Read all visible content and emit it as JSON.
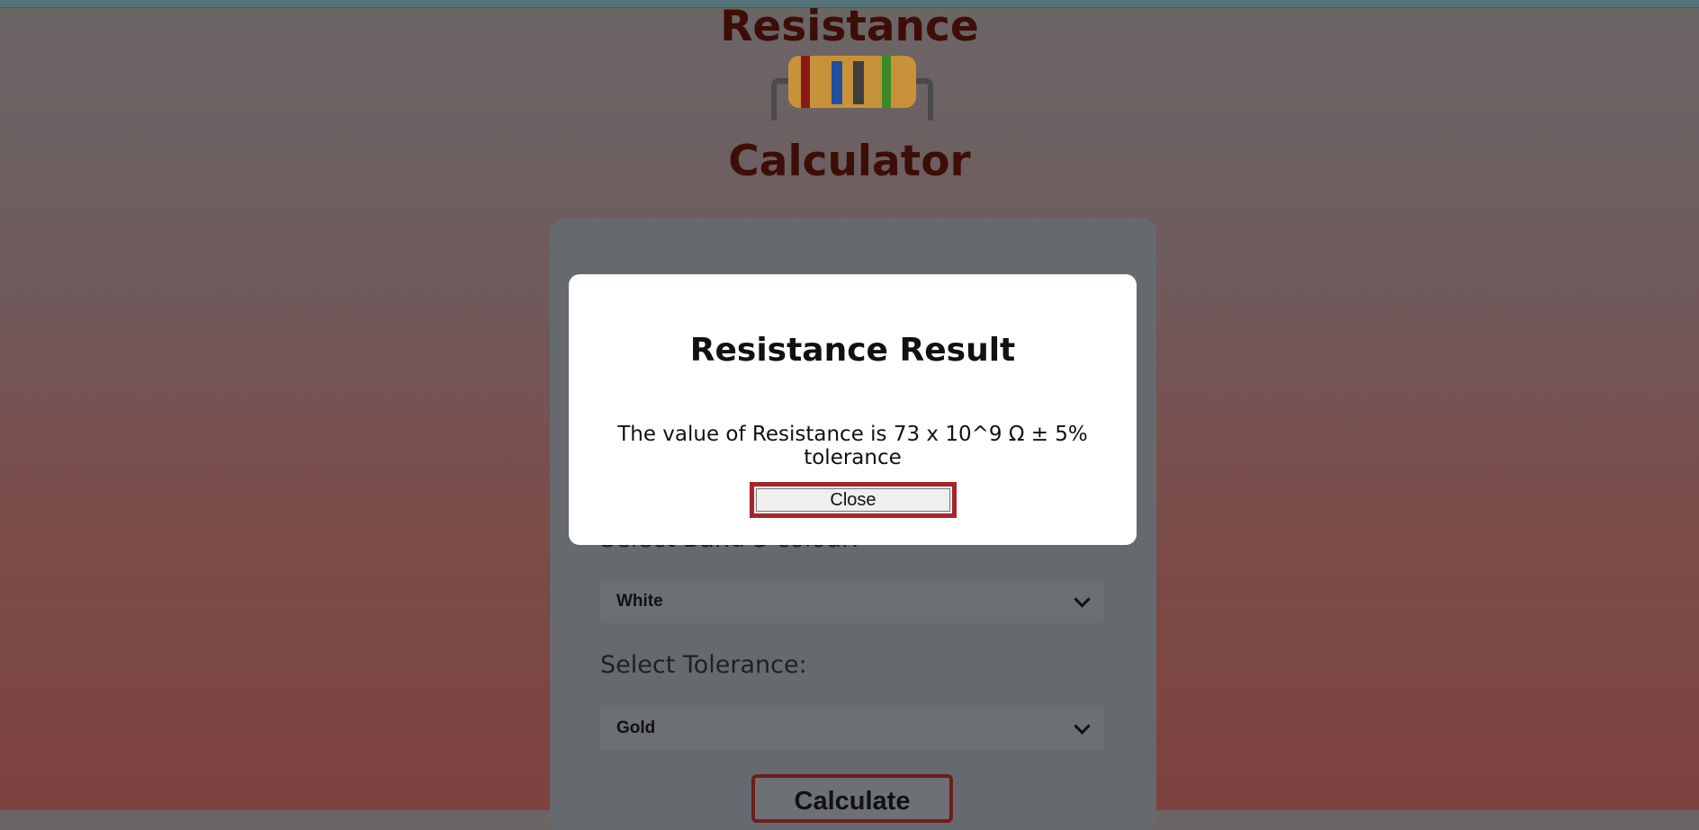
{
  "header": {
    "title_line1": "Resistance",
    "title_line2": "Calculator",
    "logo_icon": "resistor-icon"
  },
  "form": {
    "band3_label": "Select Band 3 colour:",
    "band3_value": "White",
    "tolerance_label": "Select Tolerance:",
    "tolerance_value": "Gold",
    "calculate_label": "Calculate"
  },
  "modal": {
    "title": "Resistance Result",
    "message": "The value of Resistance is 73 x 10^9 Ω ± 5% tolerance",
    "close_label": "Close"
  },
  "colors": {
    "title": "#3d0e08",
    "button_border": "#a4262c",
    "modal_bg": "#ffffff"
  }
}
